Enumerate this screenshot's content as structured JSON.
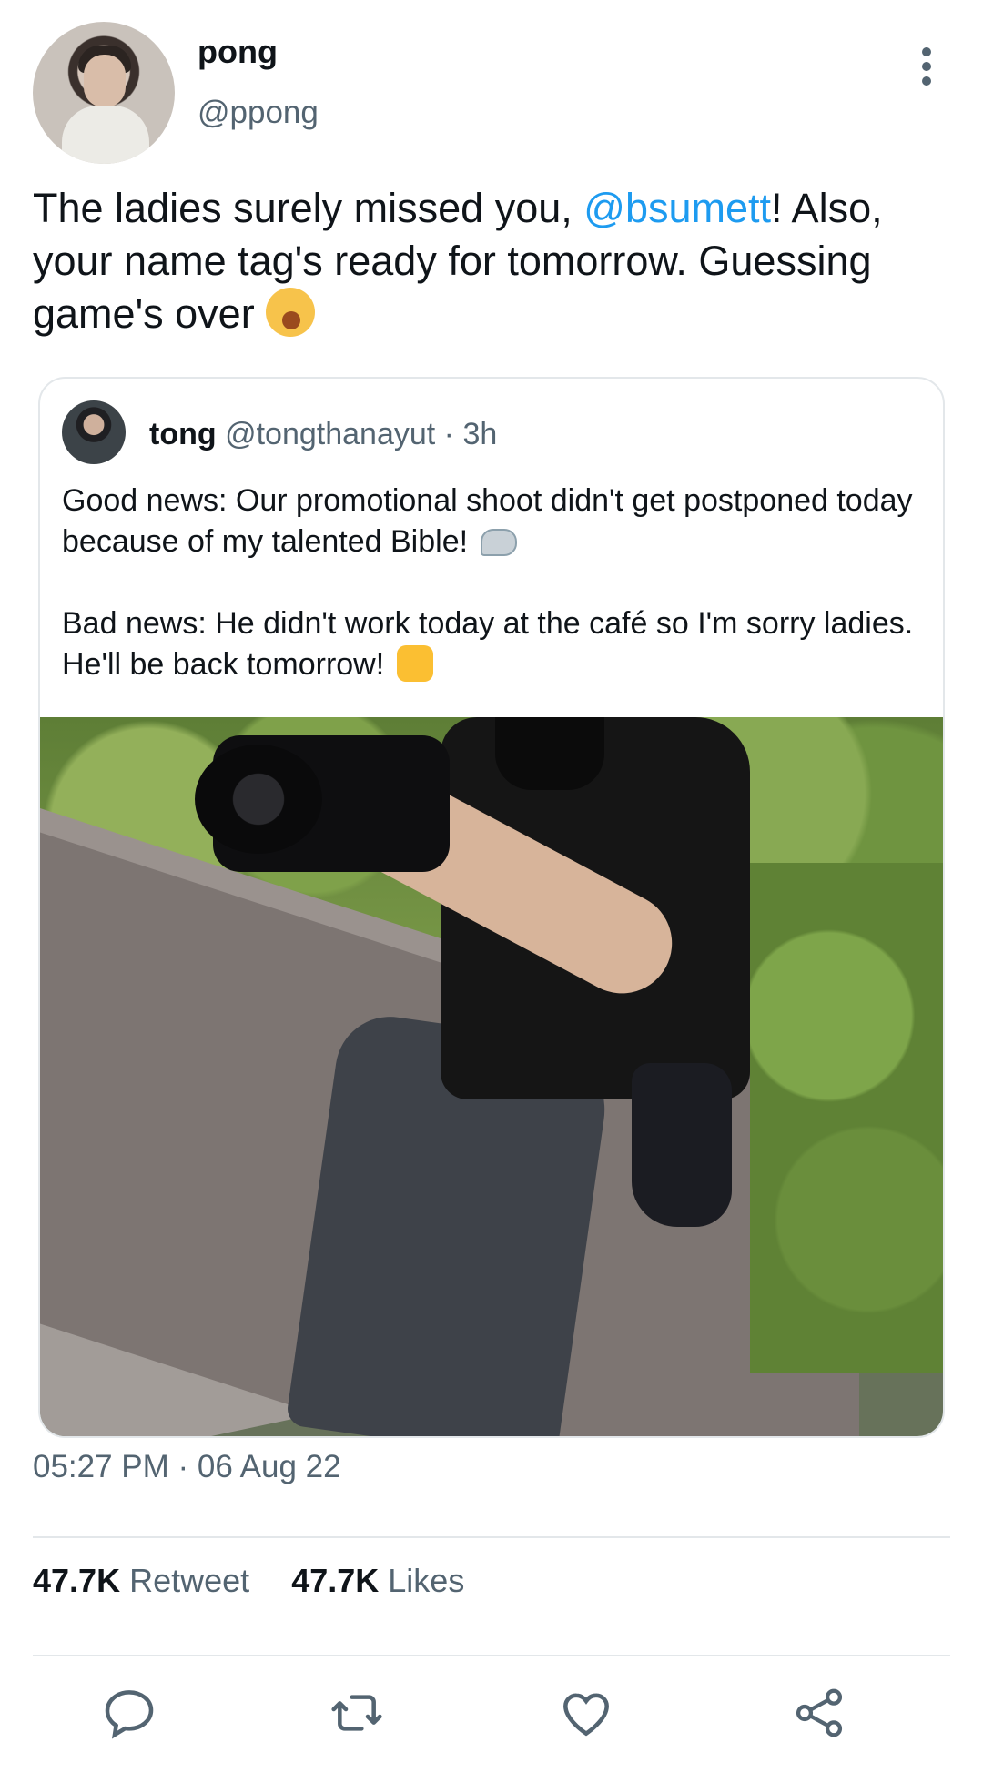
{
  "author": {
    "name": "pong",
    "handle": "@ppong"
  },
  "tweet": {
    "text_before": "The ladies surely missed you, ",
    "mention": "@bsumett",
    "text_after": "! Also, your name tag's ready for tomorrow. Guessing game's over",
    "emoji": "yawning-face-emoji"
  },
  "quote": {
    "name": "tong",
    "handle": "@tongthanayut",
    "separator": " · ",
    "age": "3h",
    "paragraph1": "Good news: Our promotional shoot didn't get postponed today because of my talented Bible!",
    "paragraph2": "Bad news: He didn't work today at the café so I'm sorry ladies. He'll be back tomorrow!",
    "emoji1": "mechanical-arm-emoji",
    "emoji2": "thumbs-up-emoji"
  },
  "meta": {
    "timestamp": "05:27 PM · 06 Aug 22"
  },
  "stats": {
    "retweets_count": "47.7K",
    "retweets_label": "Retweet",
    "likes_count": "47.7K",
    "likes_label": "Likes"
  },
  "actions": [
    "reply-icon",
    "retweet-icon",
    "like-icon",
    "share-icon"
  ],
  "colors": {
    "mention": "#1d9bf0",
    "secondary_text": "#536471",
    "divider": "#e3e7ea"
  }
}
